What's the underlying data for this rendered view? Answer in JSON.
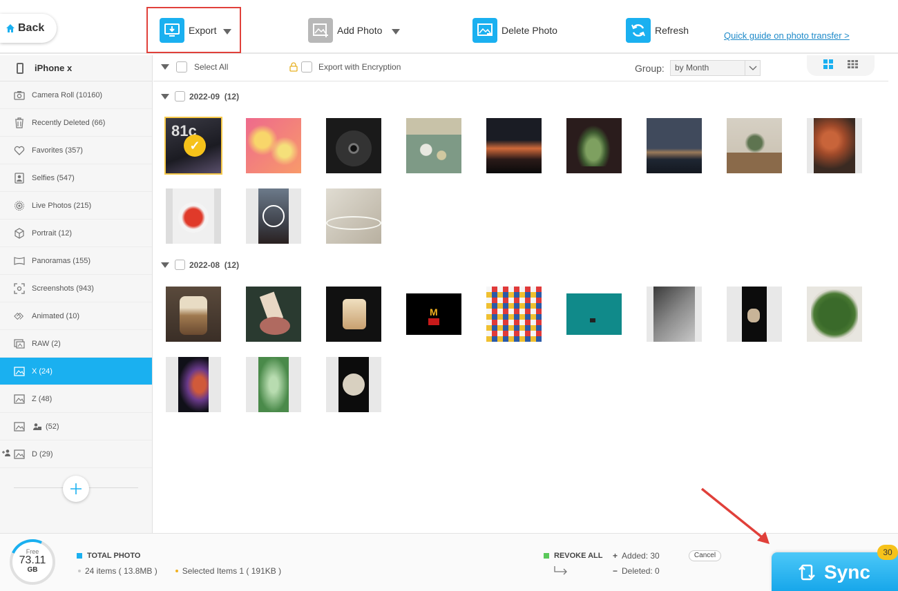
{
  "toolbar": {
    "back_label": "Back",
    "export_label": "Export",
    "add_photo_label": "Add Photo",
    "delete_photo_label": "Delete Photo",
    "refresh_label": "Refresh",
    "quick_guide_link": "Quick guide on photo transfer >"
  },
  "sidebar": {
    "device_name": "iPhone x",
    "items": [
      {
        "label": "Camera Roll (10160)",
        "icon": "camera-icon"
      },
      {
        "label": "Recently Deleted (66)",
        "icon": "trash-icon"
      },
      {
        "label": "Favorites (357)",
        "icon": "heart-icon"
      },
      {
        "label": "Selfies (547)",
        "icon": "selfie-icon"
      },
      {
        "label": "Live Photos (215)",
        "icon": "live-photo-icon"
      },
      {
        "label": "Portrait (12)",
        "icon": "cube-icon"
      },
      {
        "label": "Panoramas (155)",
        "icon": "panorama-icon"
      },
      {
        "label": "Screenshots (943)",
        "icon": "screenshot-icon"
      },
      {
        "label": "Animated (10)",
        "icon": "animated-icon"
      },
      {
        "label": "RAW (2)",
        "icon": "raw-icon"
      },
      {
        "label": "X (24)",
        "icon": "album-icon"
      },
      {
        "label": "Z (48)",
        "icon": "album-icon"
      },
      {
        "label": "(52)",
        "icon": "album-icon"
      },
      {
        "label": "D (29)",
        "icon": "album-icon"
      }
    ],
    "active_index": 10
  },
  "main": {
    "select_all_label": "Select All",
    "export_encryption_label": "Export with Encryption",
    "group_label": "Group:",
    "group_value": "by Month",
    "groups": [
      {
        "title": "2022-09",
        "count": "(12)"
      },
      {
        "title": "2022-08",
        "count": "(12)"
      }
    ]
  },
  "bottom": {
    "storage_free_label": "Free",
    "storage_value": "73.11",
    "storage_unit": "GB",
    "total_photo_label": "TOTAL PHOTO",
    "items_text": "24 items ( 13.8MB )",
    "selected_text": "Selected Items 1 ( 191KB )",
    "revoke_all_label": "REVOKE ALL",
    "added_text": "Added: 30",
    "deleted_text": "Deleted: 0",
    "cancel_label": "Cancel",
    "sync_label": "Sync",
    "sync_badge": "30"
  },
  "colors": {
    "accent": "#1ab0f0",
    "highlight_box": "#e0403a",
    "selected_badge": "#f6c21a",
    "annotation_arrow": "#e0403a"
  }
}
